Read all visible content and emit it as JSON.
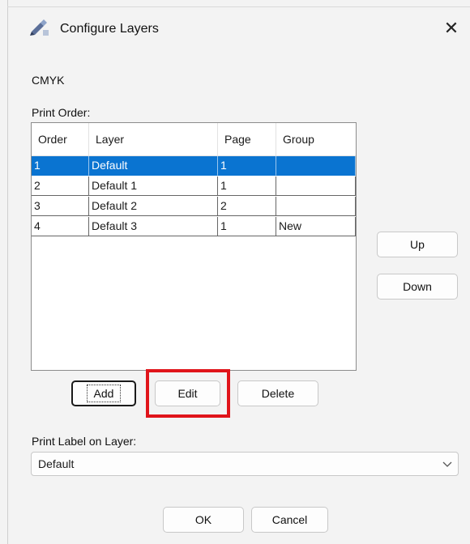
{
  "window": {
    "title": "Configure Layers",
    "icon": "brush-app-icon",
    "close_glyph": "✕"
  },
  "profile_label": "CMYK",
  "print_order": {
    "label": "Print Order:",
    "columns": [
      "Order",
      "Layer",
      "Page",
      "Group"
    ],
    "rows": [
      {
        "order": "1",
        "layer": "Default",
        "page": "1",
        "group": ""
      },
      {
        "order": "2",
        "layer": "Default 1",
        "page": "1",
        "group": ""
      },
      {
        "order": "3",
        "layer": "Default 2",
        "page": "2",
        "group": ""
      },
      {
        "order": "4",
        "layer": "Default 3",
        "page": "1",
        "group": "New"
      }
    ],
    "selected_row": 0
  },
  "side_buttons": {
    "up": "Up",
    "down": "Down"
  },
  "list_buttons": {
    "add": "Add",
    "edit": "Edit",
    "delete": "Delete"
  },
  "print_label": {
    "label": "Print Label on Layer:",
    "value": "Default"
  },
  "footer": {
    "ok": "OK",
    "cancel": "Cancel"
  },
  "colors": {
    "selection": "#0a74d1",
    "highlight_box": "#e0141a"
  }
}
